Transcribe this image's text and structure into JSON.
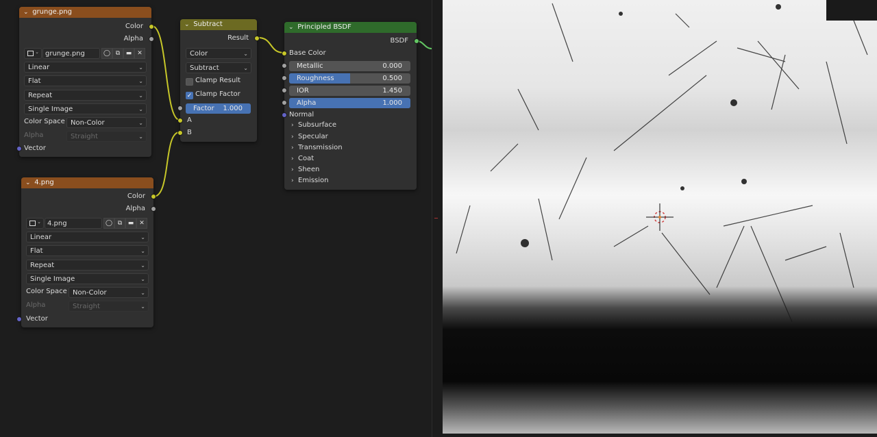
{
  "nodes": {
    "grunge": {
      "title": "grunge.png",
      "outputs": [
        "Color",
        "Alpha"
      ],
      "image_name": "grunge.png",
      "interpolation": "Linear",
      "projection": "Flat",
      "extension": "Repeat",
      "source": "Single Image",
      "color_space_label": "Color Space",
      "color_space": "Non-Color",
      "alpha_label": "Alpha",
      "alpha_mode": "Straight",
      "input_vector": "Vector"
    },
    "four": {
      "title": "4.png",
      "outputs": [
        "Color",
        "Alpha"
      ],
      "image_name": "4.png",
      "interpolation": "Linear",
      "projection": "Flat",
      "extension": "Repeat",
      "source": "Single Image",
      "color_space_label": "Color Space",
      "color_space": "Non-Color",
      "alpha_label": "Alpha",
      "alpha_mode": "Straight",
      "input_vector": "Vector"
    },
    "subtract": {
      "title": "Subtract",
      "output_result": "Result",
      "data_type": "Color",
      "blend_mode": "Subtract",
      "clamp_result_label": "Clamp Result",
      "clamp_result": false,
      "clamp_factor_label": "Clamp Factor",
      "clamp_factor": true,
      "factor_label": "Factor",
      "factor_value": "1.000",
      "input_a": "A",
      "input_b": "B"
    },
    "principled": {
      "title": "Principled BSDF",
      "output_bsdf": "BSDF",
      "base_color_label": "Base Color",
      "sliders": [
        {
          "label": "Metallic",
          "value": "0.000",
          "fill": 0
        },
        {
          "label": "Roughness",
          "value": "0.500",
          "fill": 0.5
        },
        {
          "label": "IOR",
          "value": "1.450",
          "fill": 0
        },
        {
          "label": "Alpha",
          "value": "1.000",
          "fill": 1
        }
      ],
      "normal_label": "Normal",
      "panels": [
        "Subsurface",
        "Specular",
        "Transmission",
        "Coat",
        "Sheen",
        "Emission"
      ]
    }
  },
  "icons": {
    "chevron_down": "⌄",
    "chevron_right": "›",
    "checkmark": "✓",
    "close": "✕"
  },
  "colors": {
    "image_node_header": "#8a4e1e",
    "mix_node_header": "#6c6a22",
    "shader_node_header": "#2f6b2b",
    "color_socket": "#c7c729",
    "float_socket": "#a1a1a1",
    "vector_socket": "#6363c7",
    "shader_socket": "#63c763",
    "slider_fill": "#4772b3"
  }
}
